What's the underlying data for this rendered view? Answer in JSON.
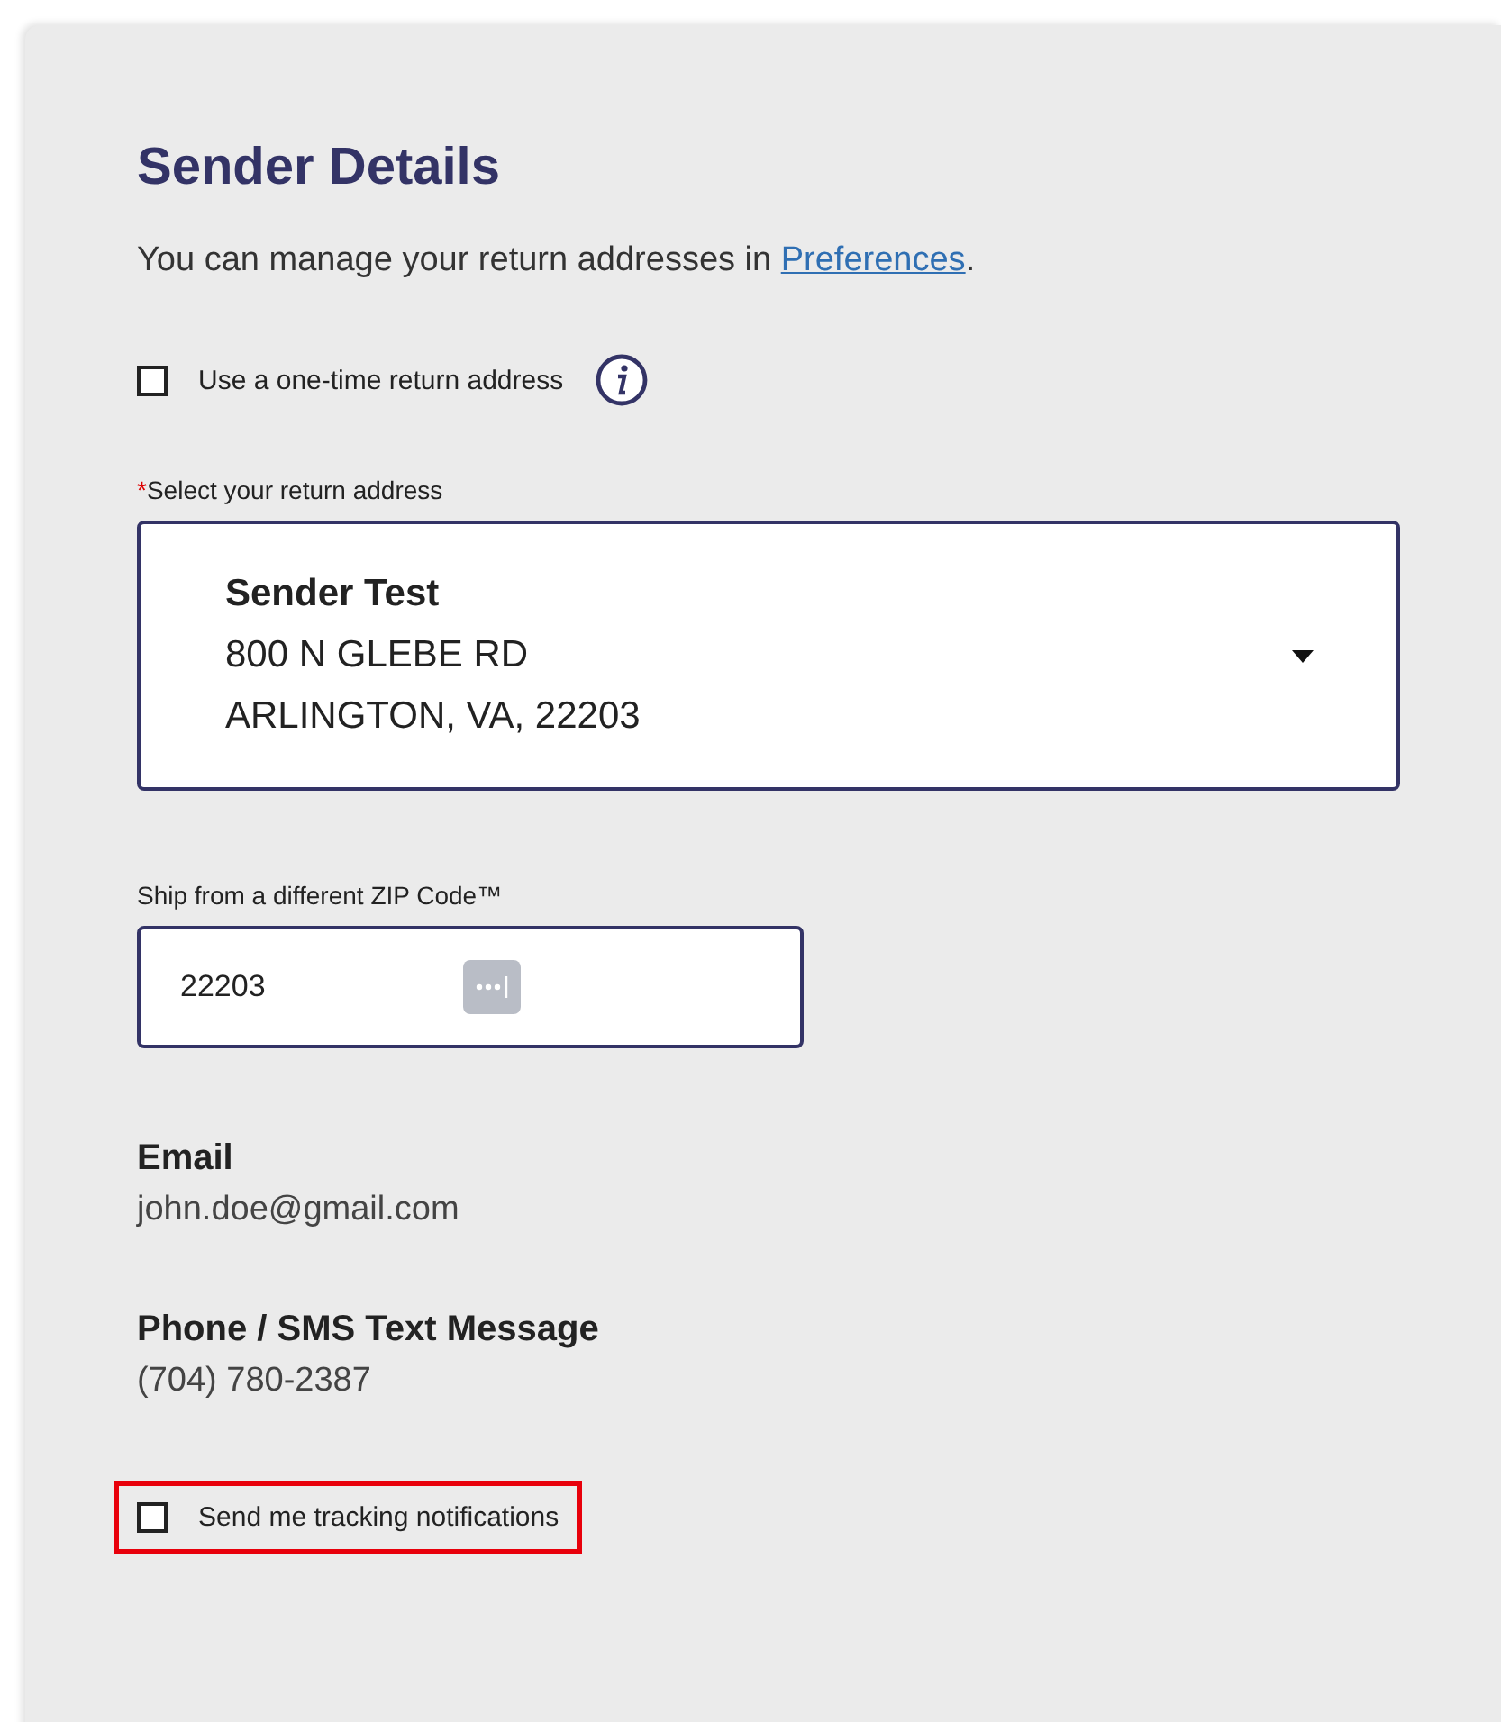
{
  "section": {
    "title": "Sender Details",
    "intro": "You can manage your return addresses in ",
    "link": "Preferences",
    "intro_end": "."
  },
  "one_time_checkbox": {
    "label": "Use a one-time return address",
    "checked": false
  },
  "return_address": {
    "required_mark": "*",
    "label": "Select your return address",
    "name": "Sender Test",
    "line1": "800 N GLEBE RD",
    "line2": "ARLINGTON, VA, 22203"
  },
  "zip": {
    "label": "Ship from a different ZIP Code™",
    "value": "22203"
  },
  "contacts": [
    {
      "label": "Email",
      "value": "john.doe@gmail.com"
    },
    {
      "label": "Phone / SMS Text Message",
      "value": "(704) 780-2387"
    }
  ],
  "tracking_checkbox": {
    "label": "Send me tracking notifications",
    "checked": false,
    "highlighted": true
  }
}
